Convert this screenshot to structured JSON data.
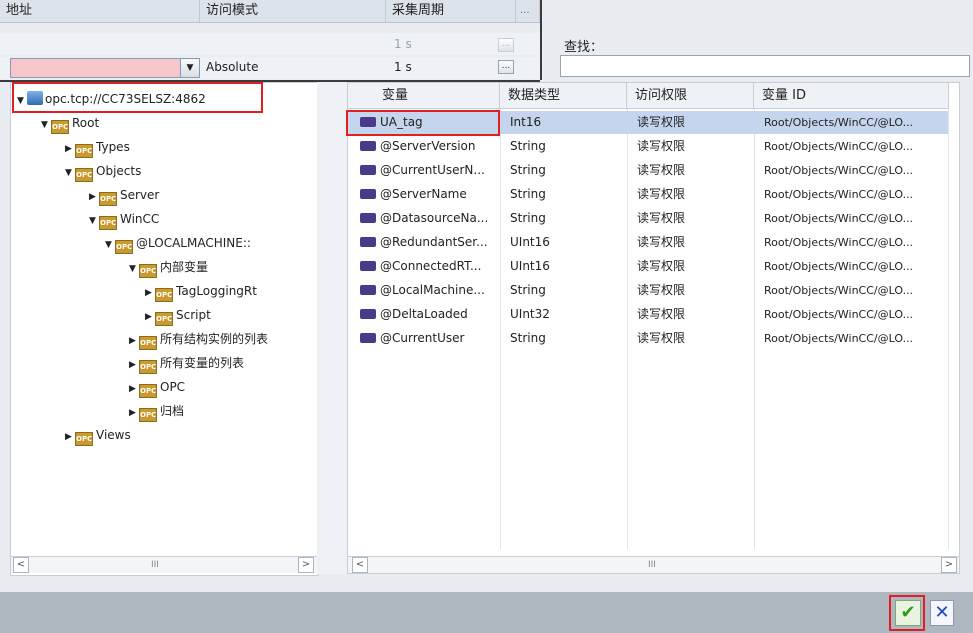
{
  "header": {
    "col_address": "地址",
    "col_access_mode": "访问模式",
    "col_cycle": "采集周期",
    "ellipsis": "..."
  },
  "row_default": {
    "cycle": "1 s"
  },
  "row_edit": {
    "access_mode": "Absolute",
    "cycle": "1 s"
  },
  "search": {
    "label": "查找：",
    "value": ""
  },
  "tree": {
    "server": "opc.tcp://CC73SELSZ:4862",
    "items": [
      {
        "label": "Root"
      },
      {
        "label": "Types"
      },
      {
        "label": "Objects"
      },
      {
        "label": "Server"
      },
      {
        "label": "WinCC"
      },
      {
        "label": "@LOCALMACHINE::"
      },
      {
        "label": "内部变量"
      },
      {
        "label": "TagLoggingRt"
      },
      {
        "label": "Script"
      },
      {
        "label": "所有结构实例的列表"
      },
      {
        "label": "所有变量的列表"
      },
      {
        "label": "OPC"
      },
      {
        "label": "归档"
      },
      {
        "label": "Views"
      }
    ],
    "icon_text": "OPC"
  },
  "table": {
    "columns": [
      "变量",
      "数据类型",
      "访问权限",
      "变量 ID"
    ],
    "rows": [
      {
        "name": "UA_tag",
        "type": "Int16",
        "access": "读写权限",
        "id": "Root/Objects/WinCC/@LO..."
      },
      {
        "name": "@ServerVersion",
        "type": "String",
        "access": "读写权限",
        "id": "Root/Objects/WinCC/@LO..."
      },
      {
        "name": "@CurrentUserN...",
        "type": "String",
        "access": "读写权限",
        "id": "Root/Objects/WinCC/@LO..."
      },
      {
        "name": "@ServerName",
        "type": "String",
        "access": "读写权限",
        "id": "Root/Objects/WinCC/@LO..."
      },
      {
        "name": "@DatasourceNa...",
        "type": "String",
        "access": "读写权限",
        "id": "Root/Objects/WinCC/@LO..."
      },
      {
        "name": "@RedundantSer...",
        "type": "UInt16",
        "access": "读写权限",
        "id": "Root/Objects/WinCC/@LO..."
      },
      {
        "name": "@ConnectedRT...",
        "type": "UInt16",
        "access": "读写权限",
        "id": "Root/Objects/WinCC/@LO..."
      },
      {
        "name": "@LocalMachine...",
        "type": "String",
        "access": "读写权限",
        "id": "Root/Objects/WinCC/@LO..."
      },
      {
        "name": "@DeltaLoaded",
        "type": "UInt32",
        "access": "读写权限",
        "id": "Root/Objects/WinCC/@LO..."
      },
      {
        "name": "@CurrentUser",
        "type": "String",
        "access": "读写权限",
        "id": "Root/Objects/WinCC/@LO..."
      }
    ]
  },
  "scroll": {
    "left": "<",
    "right": ">",
    "grip": "III"
  },
  "buttons": {
    "ok": "✔",
    "cancel": "✕"
  },
  "colors": {
    "highlight": "#e02020",
    "selected_row": "#c5d5ee",
    "address_field": "#f7c6c9"
  }
}
